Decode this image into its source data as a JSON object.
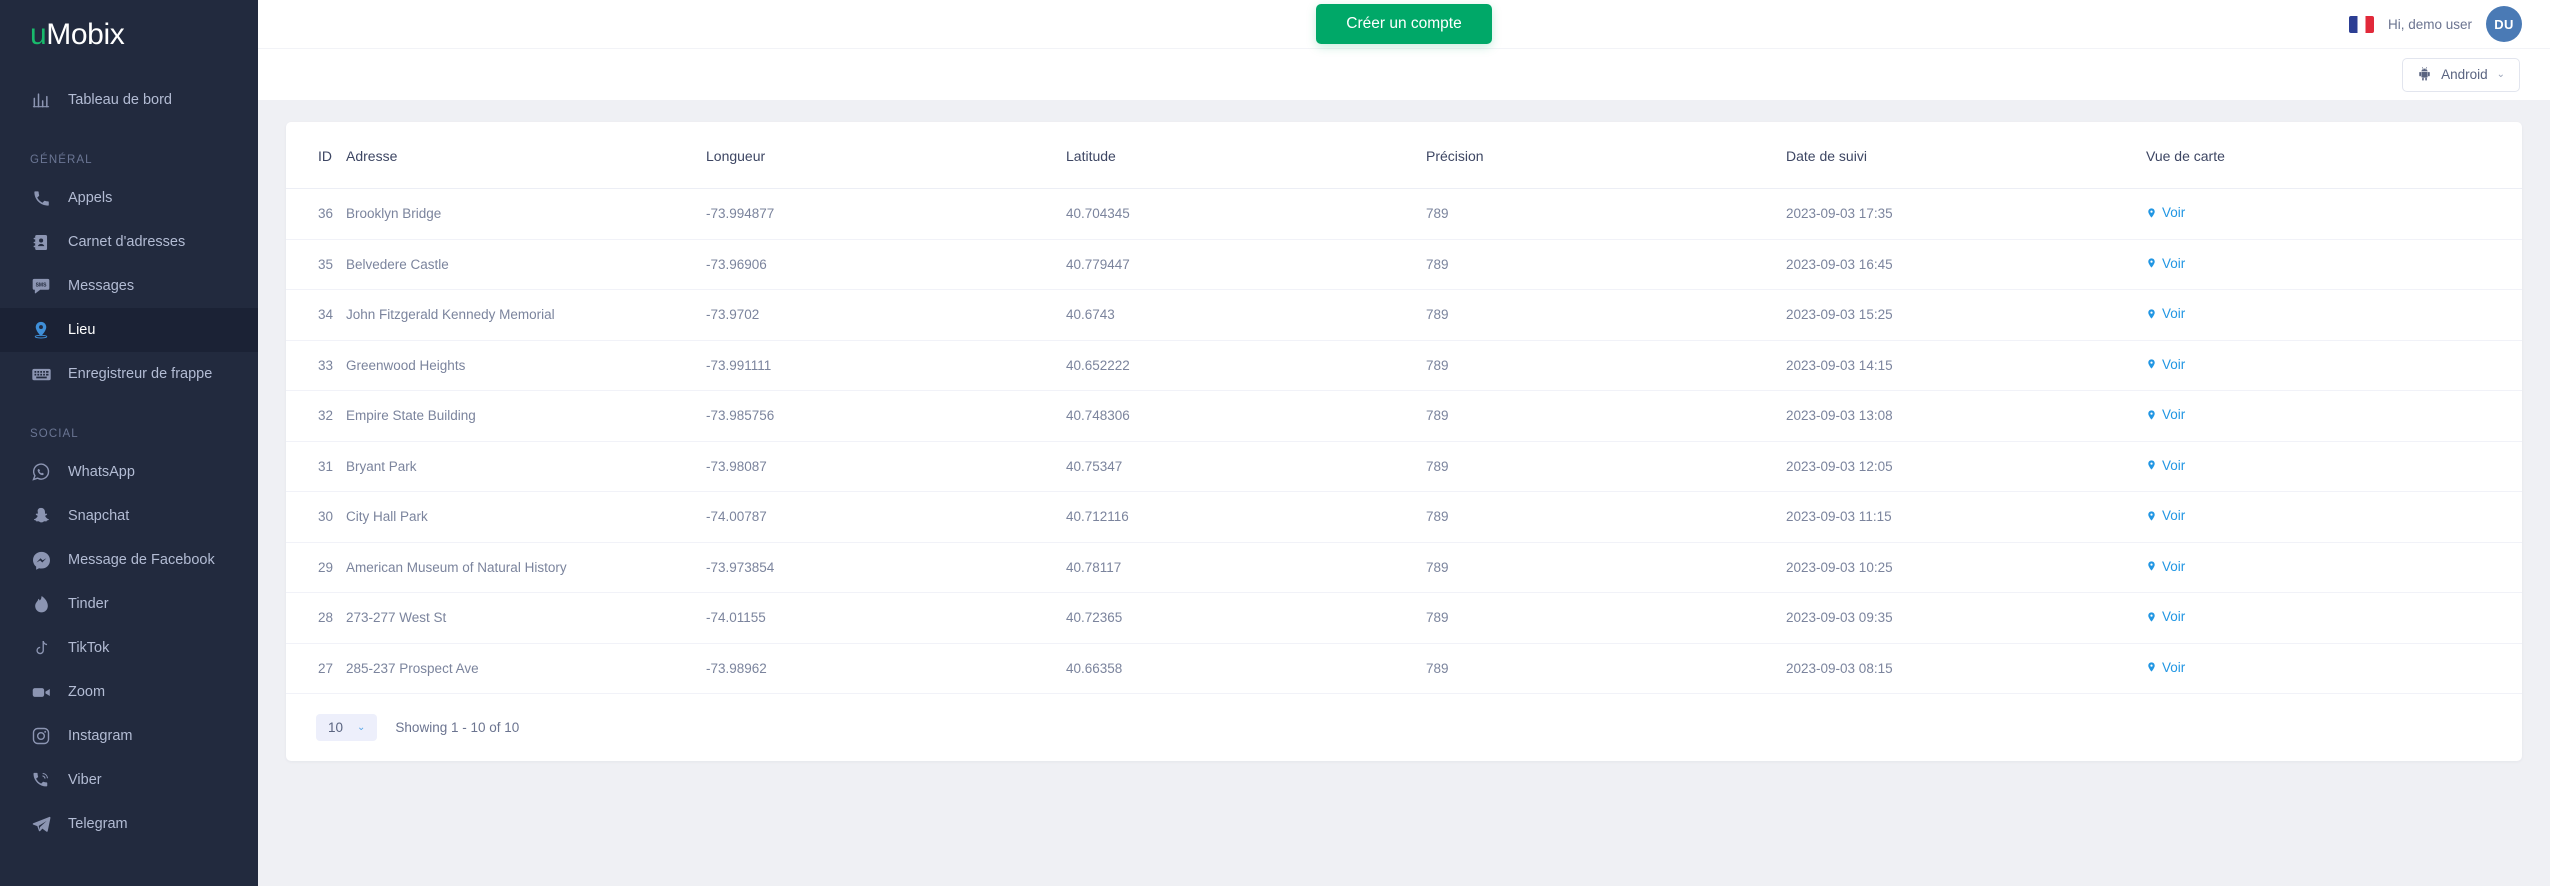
{
  "brand": {
    "prefix": "u",
    "rest": "Mobix"
  },
  "topbar": {
    "cta_label": "Créer un compte",
    "greeting": "Hi,  demo user",
    "avatar_initials": "DU",
    "flag_name": "france-flag"
  },
  "subbar": {
    "device_label": "Android",
    "chevron": "⌄"
  },
  "sidebar": {
    "dashboard": {
      "label": "Tableau de bord",
      "icon": "chart-bar-icon"
    },
    "sections": [
      {
        "title": "GÉNÉRAL",
        "items": [
          {
            "label": "Appels",
            "icon": "phone-icon",
            "active": false
          },
          {
            "label": "Carnet d'adresses",
            "icon": "contacts-book-icon",
            "active": false
          },
          {
            "label": "Messages",
            "icon": "sms-bubble-icon",
            "active": false
          },
          {
            "label": "Lieu",
            "icon": "map-pin-icon",
            "active": true
          },
          {
            "label": "Enregistreur de frappe",
            "icon": "keyboard-icon",
            "active": false
          }
        ]
      },
      {
        "title": "SOCIAL",
        "items": [
          {
            "label": "WhatsApp",
            "icon": "whatsapp-icon",
            "active": false
          },
          {
            "label": "Snapchat",
            "icon": "snapchat-ghost-icon",
            "active": false
          },
          {
            "label": "Message de Facebook",
            "icon": "facebook-messenger-icon",
            "active": false
          },
          {
            "label": "Tinder",
            "icon": "tinder-flame-icon",
            "active": false
          },
          {
            "label": "TikTok",
            "icon": "tiktok-note-icon",
            "active": false
          },
          {
            "label": "Zoom",
            "icon": "video-camera-icon",
            "active": false
          },
          {
            "label": "Instagram",
            "icon": "instagram-icon",
            "active": false
          },
          {
            "label": "Viber",
            "icon": "viber-phone-icon",
            "active": false
          },
          {
            "label": "Telegram",
            "icon": "telegram-plane-icon",
            "active": false
          }
        ]
      }
    ]
  },
  "table": {
    "columns": [
      "ID",
      "Adresse",
      "Longueur",
      "Latitude",
      "Précision",
      "Date de suivi",
      "Vue de carte"
    ],
    "view_label": "Voir",
    "rows": [
      {
        "id": "36",
        "address": "Brooklyn Bridge",
        "longitude": "-73.994877",
        "latitude": "40.704345",
        "accuracy": "789",
        "tracked_at": "2023-09-03 17:35"
      },
      {
        "id": "35",
        "address": "Belvedere Castle",
        "longitude": "-73.96906",
        "latitude": "40.779447",
        "accuracy": "789",
        "tracked_at": "2023-09-03 16:45"
      },
      {
        "id": "34",
        "address": "John Fitzgerald Kennedy Memorial",
        "longitude": "-73.9702",
        "latitude": "40.6743",
        "accuracy": "789",
        "tracked_at": "2023-09-03 15:25"
      },
      {
        "id": "33",
        "address": "Greenwood Heights",
        "longitude": "-73.991111",
        "latitude": "40.652222",
        "accuracy": "789",
        "tracked_at": "2023-09-03 14:15"
      },
      {
        "id": "32",
        "address": "Empire State Building",
        "longitude": "-73.985756",
        "latitude": "40.748306",
        "accuracy": "789",
        "tracked_at": "2023-09-03 13:08"
      },
      {
        "id": "31",
        "address": "Bryant Park",
        "longitude": "-73.98087",
        "latitude": "40.75347",
        "accuracy": "789",
        "tracked_at": "2023-09-03 12:05"
      },
      {
        "id": "30",
        "address": "City Hall Park",
        "longitude": "-74.00787",
        "latitude": "40.712116",
        "accuracy": "789",
        "tracked_at": "2023-09-03 11:15"
      },
      {
        "id": "29",
        "address": "American Museum of Natural History",
        "longitude": "-73.973854",
        "latitude": "40.78117",
        "accuracy": "789",
        "tracked_at": "2023-09-03 10:25"
      },
      {
        "id": "28",
        "address": "273-277 West St",
        "longitude": "-74.01155",
        "latitude": "40.72365",
        "accuracy": "789",
        "tracked_at": "2023-09-03 09:35"
      },
      {
        "id": "27",
        "address": "285-237 Prospect Ave",
        "longitude": "-73.98962",
        "latitude": "40.66358",
        "accuracy": "789",
        "tracked_at": "2023-09-03 08:15"
      }
    ]
  },
  "footer": {
    "page_size": "10",
    "page_size_chevron": "⌄",
    "showing": "Showing 1 - 10 of 10"
  },
  "colors": {
    "sidebar_bg": "#222a3e",
    "sidebar_active_bg": "#1b2235",
    "accent_green": "#00a868",
    "accent_blue": "#2196e3",
    "page_bg": "#eff0f4",
    "avatar_bg": "#4a7ab5"
  }
}
